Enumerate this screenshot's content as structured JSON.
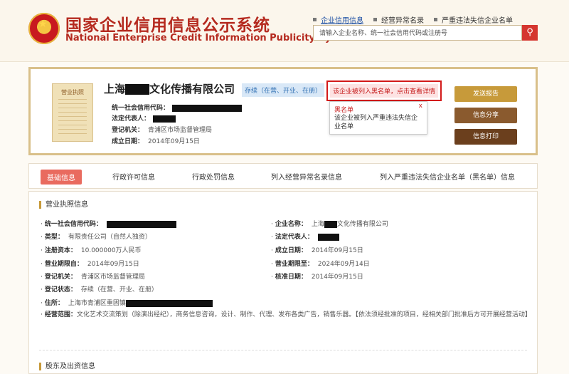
{
  "header": {
    "title": "国家企业信用信息公示系统",
    "subtitle": "National Enterprise Credit Information Publicity System",
    "links": [
      "企业信用信息",
      "经营异常名录",
      "严重违法失信企业名单"
    ],
    "search_placeholder": "请输入企业名称、统一社会信用代码或注册号"
  },
  "card": {
    "license_label": "营业执照",
    "company_prefix": "上海",
    "company_suffix": "文化传播有限公司",
    "status": "存续（在营、开业、在册）",
    "blacklist_alert": "该企业被列入黑名单，点击查看详情",
    "popup": {
      "title": "黑名单",
      "text": "该企业被列入严重违法失信企业名单",
      "close": "x"
    },
    "fields": {
      "credit_code": "统一社会信用代码：",
      "legal_rep": "法定代表人：",
      "reg_authority": "登记机关：",
      "reg_authority_value": "青浦区市场监督管理局",
      "est_date": "成立日期：",
      "est_date_value": "2014年09月15日"
    },
    "buttons": {
      "report": "发送报告",
      "share": "信息分享",
      "print": "信息打印"
    }
  },
  "tabs": [
    "基础信息",
    "行政许可信息",
    "行政处罚信息",
    "列入经营异常名录信息",
    "列入严重违法失信企业名单（黑名单）信息"
  ],
  "main": {
    "section1": "营业执照信息",
    "left": [
      {
        "k": "统一社会信用代码：",
        "v": ""
      },
      {
        "k": "类型：",
        "v": "有限责任公司（自然人独资）"
      },
      {
        "k": "注册资本：",
        "v": "10.000000万人民币"
      },
      {
        "k": "营业期限自：",
        "v": "2014年09月15日"
      },
      {
        "k": "登记机关：",
        "v": "青浦区市场监督管理局"
      },
      {
        "k": "登记状态：",
        "v": "存续（在营、开业、在册）"
      },
      {
        "k": "住所：",
        "v": "上海市青浦区重固镇"
      }
    ],
    "right": [
      {
        "k": "企业名称：",
        "v": "上海"
      },
      {
        "k": "法定代表人：",
        "v": ""
      },
      {
        "k": "成立日期：",
        "v": "2014年09月15日"
      },
      {
        "k": "营业期限至：",
        "v": "2024年09月14日"
      },
      {
        "k": "核准日期：",
        "v": "2014年09月15日"
      }
    ],
    "company_name_suffix": "文化传播有限公司",
    "scope_label": "经营范围：",
    "scope_value": "文化艺术交流策划（除演出经纪），商务信息咨询，设计、制作、代理、发布各类广告，销售乐器。【依法须经批准的项目，经相关部门批准后方可开展经营活动】",
    "section2": "股东及出资信息"
  }
}
